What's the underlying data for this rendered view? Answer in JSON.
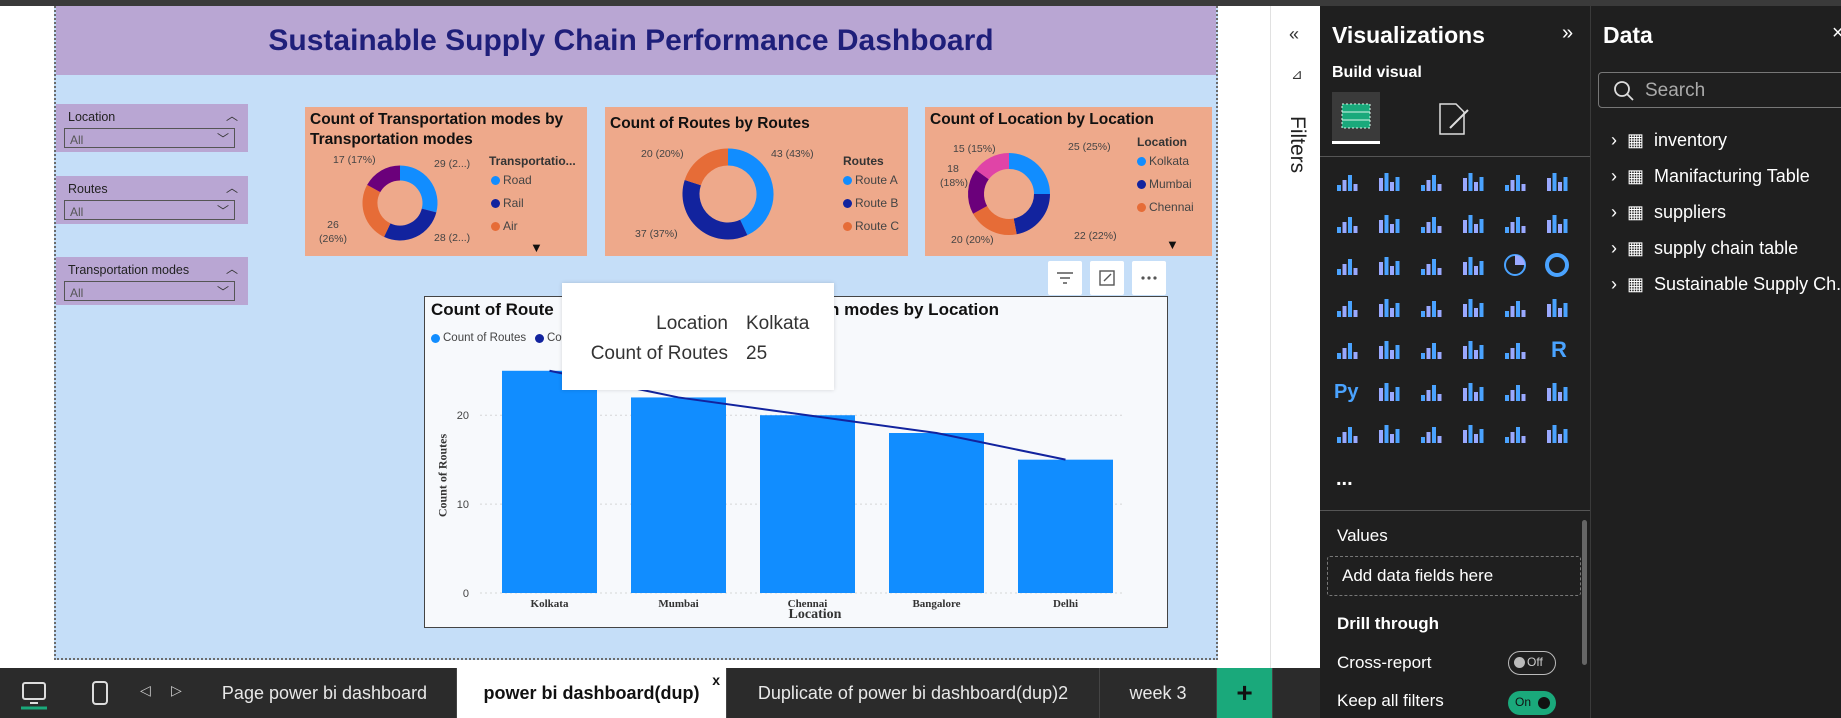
{
  "dashboard_title": "Sustainable Supply Chain Performance Dashboard",
  "slicers": [
    {
      "label": "Location",
      "value": "All"
    },
    {
      "label": "Routes",
      "value": "All"
    },
    {
      "label": "Transportation modes",
      "value": "All"
    }
  ],
  "donut_cards": [
    {
      "title": "Count of Transportation modes by Transportation modes",
      "legend_title": "Transportatio...",
      "slices": [
        {
          "name": "Road",
          "value": 29,
          "label": "29 (2...)",
          "color": "#118dff"
        },
        {
          "name": "Rail",
          "value": 28,
          "label": "28 (2...)",
          "color": "#12239e"
        },
        {
          "name": "Air",
          "value": 26,
          "label": "26 (26%)",
          "color": "#e66c37"
        },
        {
          "name": "",
          "value": 17,
          "label": "17 (17%)",
          "color": "#6b007b"
        }
      ]
    },
    {
      "title": "Count of Routes by Routes",
      "legend_title": "Routes",
      "slices": [
        {
          "name": "Route A",
          "value": 43,
          "label": "43 (43%)",
          "color": "#118dff"
        },
        {
          "name": "Route B",
          "value": 37,
          "label": "37 (37%)",
          "color": "#12239e"
        },
        {
          "name": "Route C",
          "value": 20,
          "label": "20 (20%)",
          "color": "#e66c37"
        }
      ]
    },
    {
      "title": "Count of Location by Location",
      "legend_title": "Location",
      "slices": [
        {
          "name": "Kolkata",
          "value": 25,
          "label": "25 (25%)",
          "color": "#118dff"
        },
        {
          "name": "Mumbai",
          "value": 22,
          "label": "22 (22%)",
          "color": "#12239e"
        },
        {
          "name": "Chennai",
          "value": 20,
          "label": "20 (20%)",
          "color": "#e66c37"
        },
        {
          "name": "",
          "value": 18,
          "label": "18 (18%)",
          "color": "#6b007b"
        },
        {
          "name": "",
          "value": 15,
          "label": "15 (15%)",
          "color": "#e044a7"
        }
      ]
    }
  ],
  "chart_data": {
    "type": "bar",
    "title": "Count of Routes and Count of Transportation modes by Location",
    "title_left": "Count of Route",
    "title_right": "n modes by Location",
    "legend": [
      "Count of Routes",
      "Cou"
    ],
    "categories": [
      "Kolkata",
      "Mumbai",
      "Chennai",
      "Bangalore",
      "Delhi"
    ],
    "series": [
      {
        "name": "Count of Routes",
        "values": [
          25,
          22,
          20,
          18,
          15
        ],
        "color": "#118dff"
      },
      {
        "name": "Count of Transportation modes",
        "values": [
          25,
          22,
          20,
          18,
          15
        ],
        "color": "#12239e",
        "type": "line"
      }
    ],
    "ylabel": "Count of Routes",
    "xlabel": "Location",
    "yticks": [
      "0",
      "10",
      "20"
    ],
    "ylim": [
      0,
      27
    ]
  },
  "tooltip": {
    "k1": "Location",
    "v1": "Kolkata",
    "k2": "Count of Routes",
    "v2": "25"
  },
  "filters_label": "Filters",
  "visualizations": {
    "title": "Visualizations",
    "build_visual": "Build visual",
    "values_label": "Values",
    "add_fields": "Add data fields here",
    "drill_through": "Drill through",
    "cross_report": "Cross-report",
    "cross_report_state": "Off",
    "keep_filters": "Keep all filters",
    "keep_filters_state": "On",
    "more": "..."
  },
  "data_pane": {
    "title": "Data",
    "search_placeholder": "Search",
    "tables": [
      "inventory",
      "Manifacturing Table",
      "suppliers",
      "supply chain table",
      "Sustainable Supply Ch..."
    ]
  },
  "page_tabs": [
    "Page power bi dashboard",
    "power bi dashboard(dup)",
    "Duplicate of power bi dashboard(dup)2",
    "week 3"
  ],
  "active_tab": 1,
  "tab_close": "x",
  "add_page": "+"
}
